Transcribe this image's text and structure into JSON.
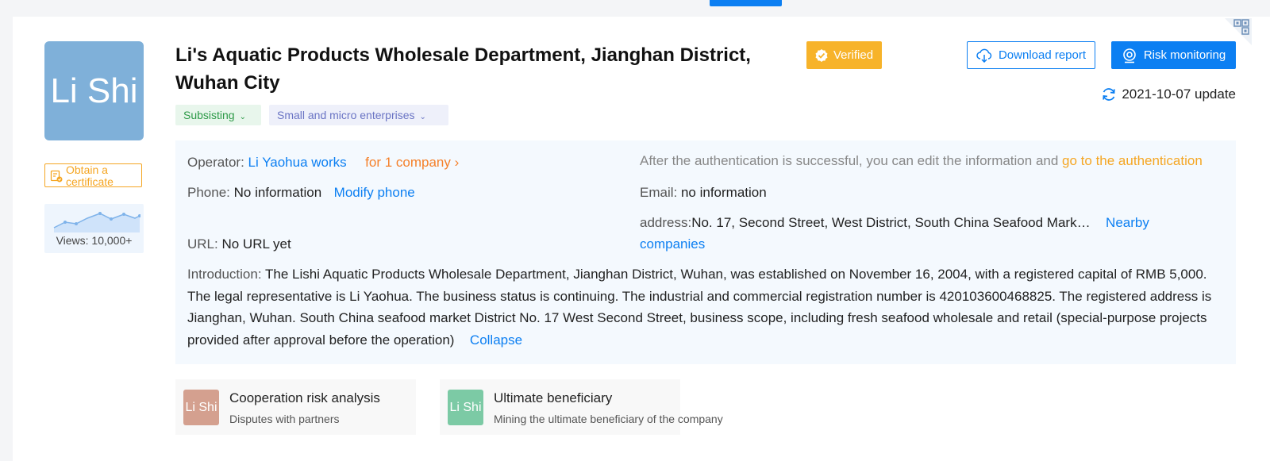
{
  "company": {
    "logo_text": "Li Shi",
    "name": "Li's Aquatic Products Wholesale Department, Jianghan District, Wuhan City",
    "verified_label": "Verified",
    "status_tag": "Subsisting",
    "scale_tag": "Small and micro enterprises"
  },
  "left_panel": {
    "certificate_label": "Obtain a certificate",
    "views_label": "Views: 10,000+"
  },
  "actions": {
    "download_label": "Download report",
    "risk_label": "Risk monitoring",
    "update_text": "2021-10-07 update"
  },
  "info": {
    "operator_label": "Operator:",
    "operator_value": "Li Yaohua works",
    "operator_companies": "for 1 company",
    "auth_note": "After the authentication is successful, you can edit the information and",
    "auth_link": "go to the authentication",
    "phone_label": "Phone:",
    "phone_value": "No information",
    "modify_phone": "Modify phone",
    "email_label": "Email:",
    "email_value": "no information",
    "address_label": "address:",
    "address_value": "No. 17, Second Street, West District, South China Seafood Mark…",
    "nearby_link_1": "Nearby",
    "nearby_link_2": "companies",
    "url_label": "URL:",
    "url_value": "No URL yet",
    "intro_label": "Introduction:",
    "intro_text": "The Lishi Aquatic Products Wholesale Department, Jianghan District, Wuhan, was established on November 16, 2004, with a registered capital of RMB 5,000. The legal representative is Li Yaohua. The business status is continuing. The industrial and commercial registration number is 420103600468825. The registered address is Jianghan, Wuhan. South China seafood market District No. 17 West Second Street, business scope, including fresh seafood wholesale and retail (special-purpose projects provided after approval before the operation)",
    "collapse_link": "Collapse"
  },
  "risk_cards": [
    {
      "badge": "Li Shi",
      "title": "Cooperation risk analysis",
      "subtitle": "Disputes with partners",
      "badge_color": "#d4a08f"
    },
    {
      "badge": "Li Shi",
      "title": "Ultimate beneficiary",
      "subtitle": "Mining the ultimate beneficiary of the company",
      "badge_color": "#7ccaa5"
    }
  ],
  "colors": {
    "primary": "#0c7ff2",
    "verified": "#f7b32a",
    "status_green": "#2d9a48",
    "link_orange": "#f5812b"
  }
}
